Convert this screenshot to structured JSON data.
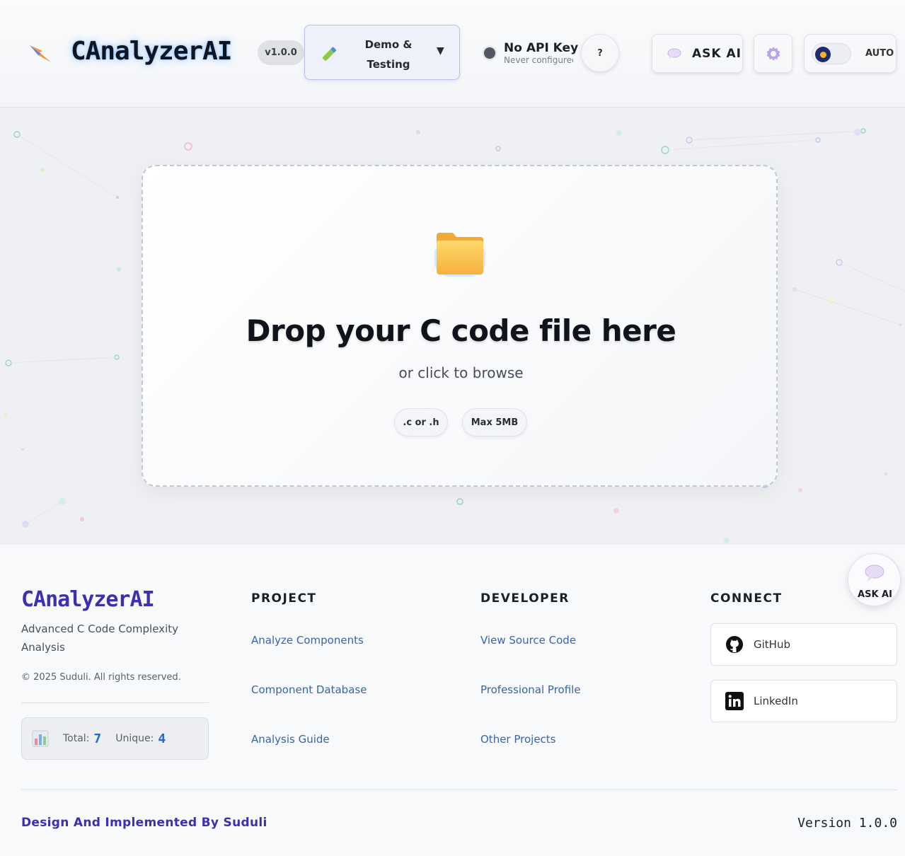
{
  "header": {
    "brand": "CAnalyzerAI",
    "version_badge": "v1.0.0",
    "mode_select": {
      "label": "Demo & Testing",
      "caret": "▼"
    },
    "api_status": {
      "title": "No API Key",
      "subtitle": "Never configured"
    },
    "help_label": "?",
    "ask_ai_label": "ASK AI",
    "theme_label": "AUTO"
  },
  "dropzone": {
    "title": "Drop your C code file here",
    "subtitle": "or click to browse",
    "chips": [
      ".c or .h",
      "Max 5MB"
    ]
  },
  "footer": {
    "brand": "CAnalyzerAI",
    "description": "Advanced C Code Complexity Analysis",
    "copyright": "© 2025 Suduli. All rights reserved.",
    "stats": {
      "total_label": "Total:",
      "total_value": "7",
      "unique_label": "Unique:",
      "unique_value": "4"
    },
    "project": {
      "heading": "PROJECT",
      "links": [
        "Analyze Components",
        "Component Database",
        "Analysis Guide"
      ]
    },
    "developer": {
      "heading": "DEVELOPER",
      "links": [
        "View Source Code",
        "Professional Profile",
        "Other Projects"
      ]
    },
    "connect": {
      "heading": "CONNECT",
      "links": [
        "GitHub",
        "LinkedIn"
      ]
    },
    "credit": "Design And Implemented By Suduli",
    "version": "Version 1.0.0"
  },
  "floating_ask": {
    "label": "ASK AI"
  },
  "colors": {
    "brand_purple": "#3b2fb2",
    "link_blue": "#3a63ad",
    "stat_blue": "#1f6ae0",
    "glow": "#288cff"
  },
  "icons": [
    "bolt-logo-icon",
    "pencil-icon",
    "status-dot",
    "speech-bubble-icon",
    "gear-icon",
    "moon-sun-icon",
    "folder-icon",
    "bar-chart-icon",
    "github-icon",
    "linkedin-icon"
  ]
}
